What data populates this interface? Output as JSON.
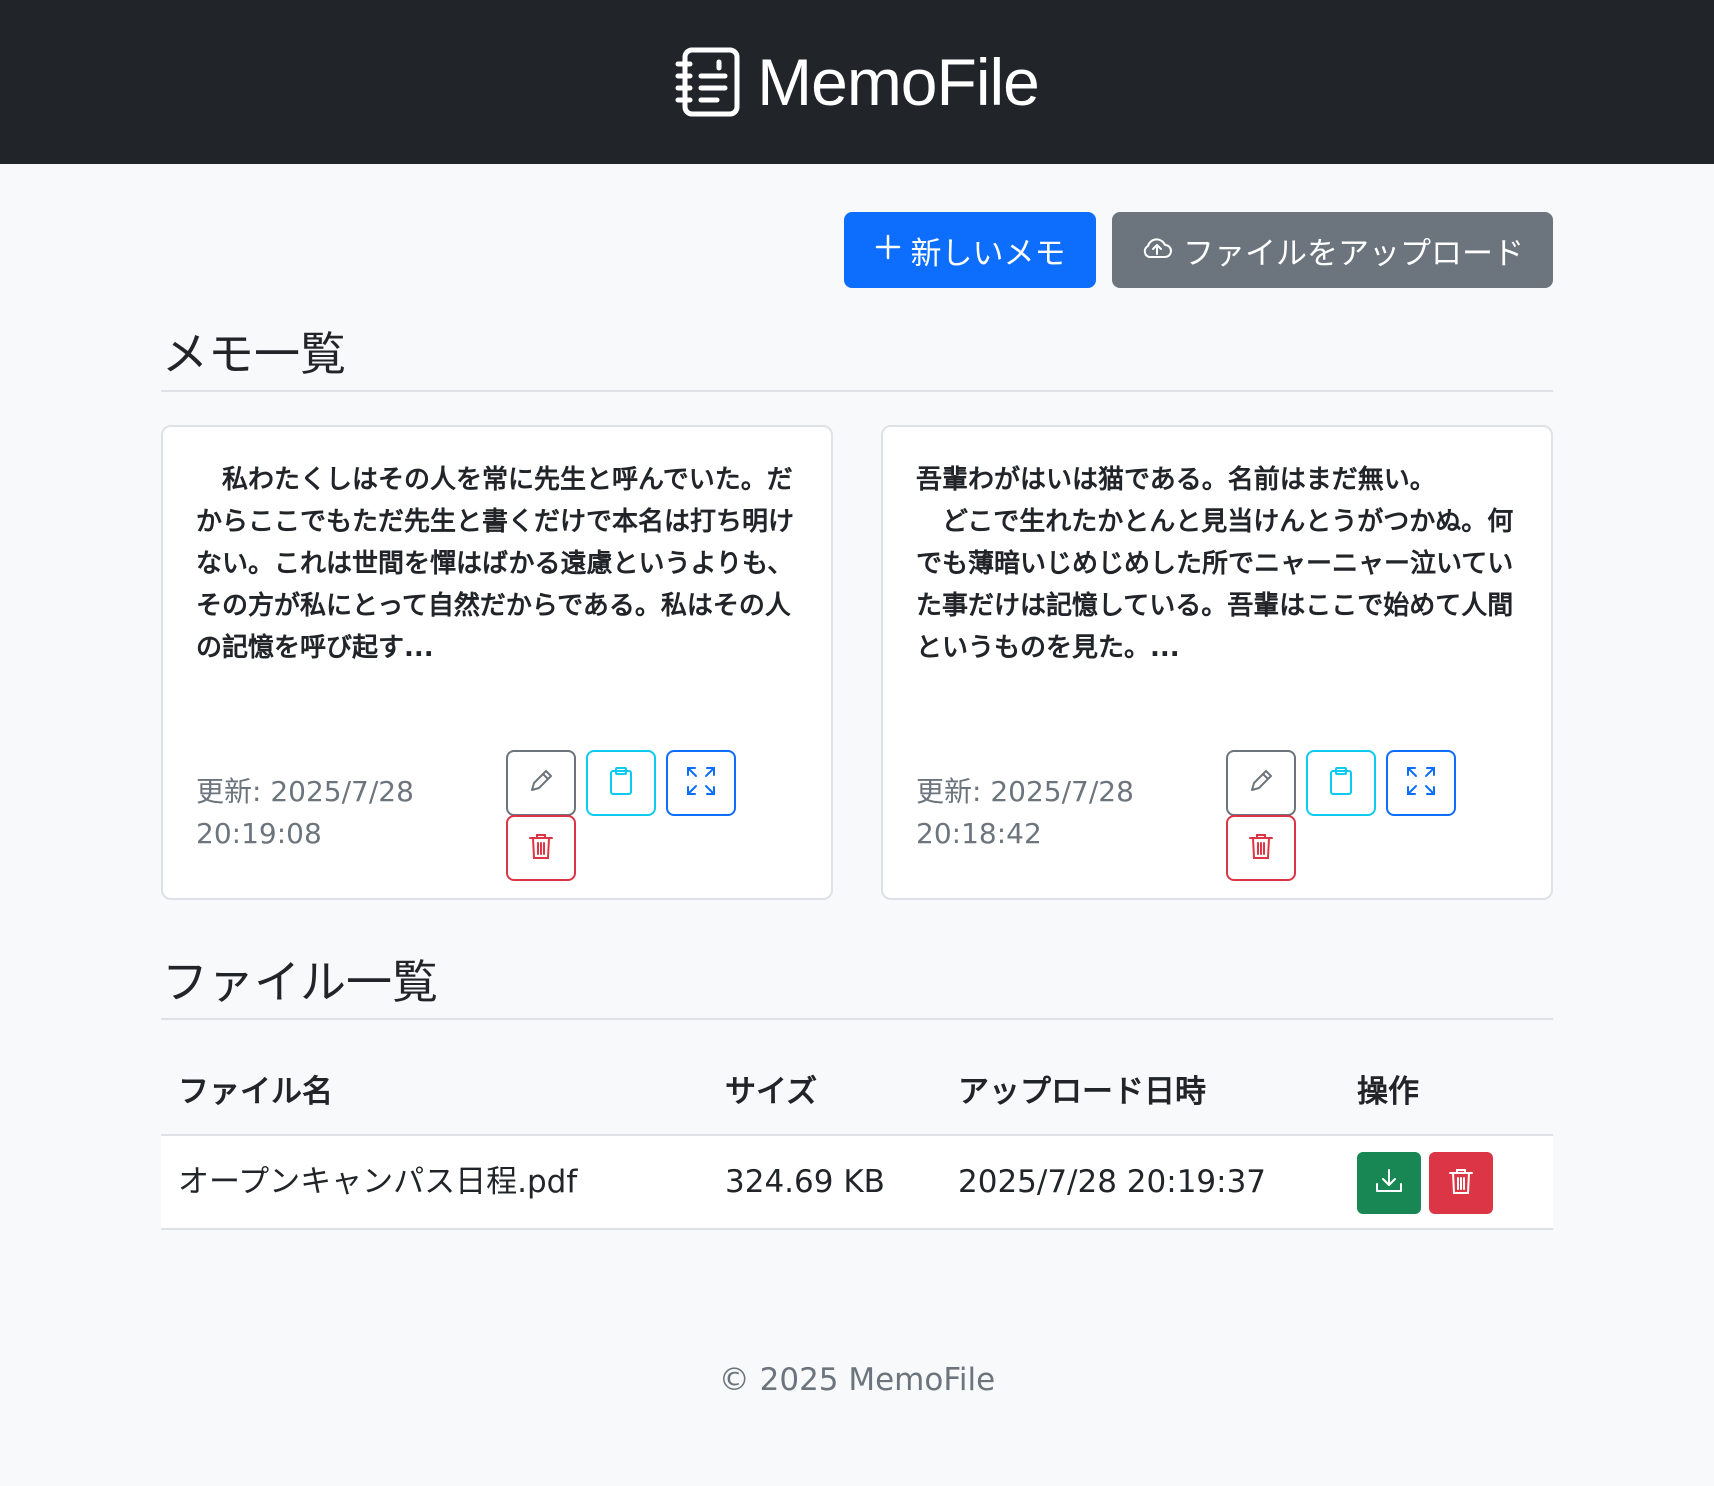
{
  "header": {
    "brand": "MemoFile",
    "brand_icon": "journal-text-icon"
  },
  "actions": {
    "new_memo": "新しいメモ",
    "upload_file": "ファイルをアップロード"
  },
  "memos_section": {
    "title": "メモ一覧",
    "memos": [
      {
        "text": "　私わたくしはその人を常に先生と呼んでいた。だからここでもただ先生と書くだけで本名は打ち明けない。これは世間を憚はばかる遠慮というよりも、その方が私にとって自然だからである。私はその人の記憶を呼び起す...",
        "updated": "更新: 2025/7/28\n20:19:08"
      },
      {
        "text": "吾輩わがはいは猫である。名前はまだ無い。\n　どこで生れたかとんと見当けんとうがつかぬ。何でも薄暗いじめじめした所でニャーニャー泣いていた事だけは記憶している。吾輩はここで始めて人間というものを見た。...",
        "updated": "更新: 2025/7/28\n20:18:42"
      }
    ]
  },
  "files_section": {
    "title": "ファイル一覧",
    "columns": [
      "ファイル名",
      "サイズ",
      "アップロード日時",
      "操作"
    ],
    "rows": [
      {
        "name": "オープンキャンパス日程.pdf",
        "size": "324.69 KB",
        "uploaded": "2025/7/28 20:19:37"
      }
    ]
  },
  "footer": {
    "text": "© 2025 MemoFile"
  },
  "colors": {
    "primary": "#0d6efd",
    "secondary": "#6c757d",
    "info": "#0dcaf0",
    "danger": "#dc3545",
    "success": "#198754",
    "navbar": "#212529"
  }
}
